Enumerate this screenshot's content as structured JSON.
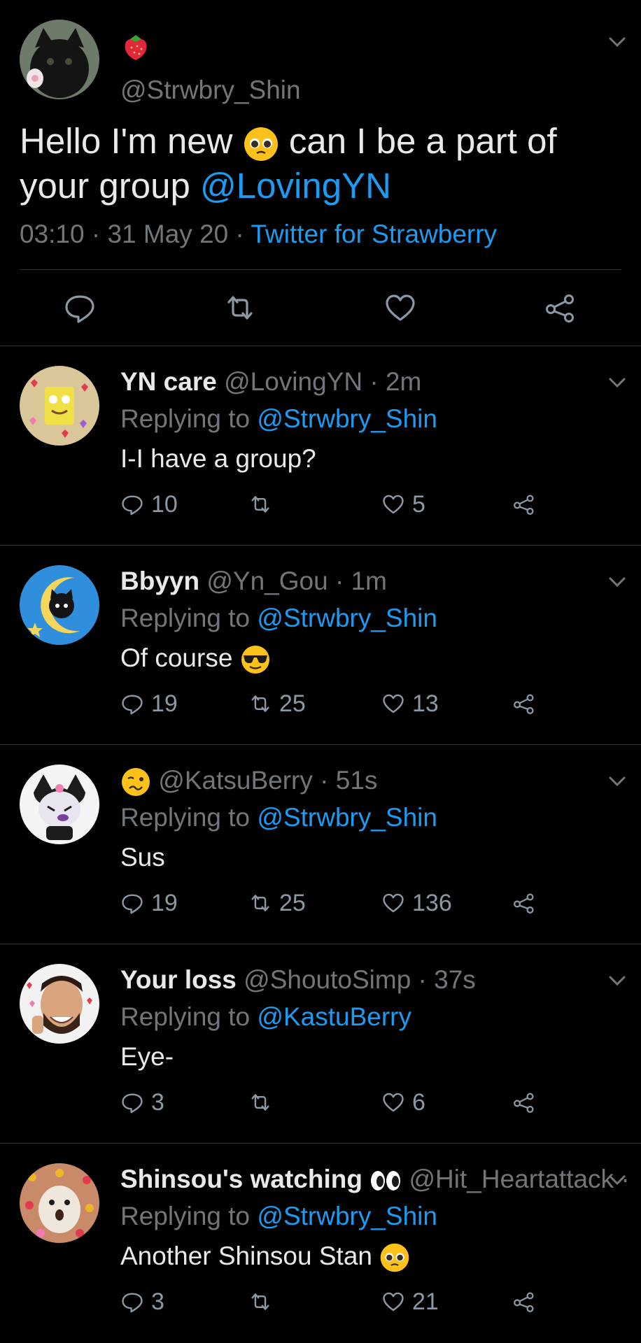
{
  "main_tweet": {
    "handle": "@Strwbry_Shin",
    "text_1": "Hello I'm new",
    "text_2": "can I be a part of",
    "text_3": "your group",
    "mention": "@LovingYN",
    "time": "03:10 · 31 May 20 ·",
    "source": "Twitter for Strawberry"
  },
  "replies": [
    {
      "name": "YN care",
      "handle": "@LovingYN · 2m",
      "replying_label": "Replying to",
      "replying_to": "@Strwbry_Shin",
      "text": "I-I have a group?",
      "replies": "10",
      "retweets": "",
      "likes": "5"
    },
    {
      "name": "Bbyyn",
      "handle": "@Yn_Gou · 1m",
      "replying_label": "Replying to",
      "replying_to": "@Strwbry_Shin",
      "text": "Of course",
      "replies": "19",
      "retweets": "25",
      "likes": "13"
    },
    {
      "name": "",
      "handle": "@KatsuBerry · 51s",
      "replying_label": "Replying to",
      "replying_to": "@Strwbry_Shin",
      "text": "Sus",
      "replies": "19",
      "retweets": "25",
      "likes": "136"
    },
    {
      "name": "Your loss",
      "handle": "@ShoutoSimp · 37s",
      "replying_label": "Replying to",
      "replying_to": "@KastuBerry",
      "text": "Eye-",
      "replies": "3",
      "retweets": "",
      "likes": "6"
    },
    {
      "name": "Shinsou's watching",
      "handle": "@Hit_Heartattack ·",
      "replying_label": "Replying to",
      "replying_to": "@Strwbry_Shin",
      "text": "Another Shinsou Stan",
      "replies": "3",
      "retweets": "",
      "likes": "21"
    }
  ],
  "colors": {
    "link": "#1d9bf0",
    "muted": "#71767b",
    "divider": "#2f3336"
  }
}
